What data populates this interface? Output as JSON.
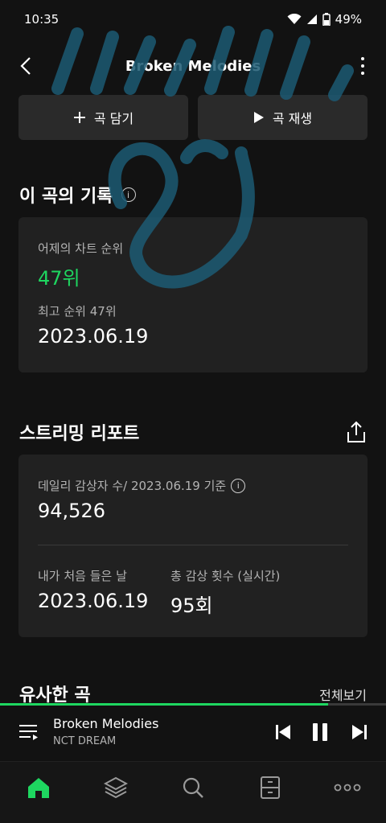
{
  "status": {
    "time": "10:35",
    "battery": "49%"
  },
  "header": {
    "title": "Broken Melodies"
  },
  "actions": {
    "add_label": "곡 담기",
    "play_label": "곡 재생"
  },
  "record": {
    "title": "이 곡의 기록",
    "yesterday_label": "어제의 차트 순위",
    "yesterday_value": "47위",
    "best_label": "최고 순위 47위",
    "best_date": "2023.06.19"
  },
  "report": {
    "title": "스트리밍 리포트",
    "daily_label": "데일리 감상자 수/ 2023.06.19 기준",
    "daily_value": "94,526",
    "first_label": "내가 처음 들은 날",
    "first_value": "2023.06.19",
    "total_label": "총 감상 횟수 (실시간)",
    "total_value": "95회"
  },
  "similar": {
    "title": "유사한 곡",
    "see_all": "전체보기"
  },
  "player": {
    "title": "Broken Melodies",
    "artist": "NCT DREAM",
    "progress": 0.85
  },
  "colors": {
    "accent": "#1ed760",
    "background": "#121212",
    "card": "#212121",
    "doodle": "#1c5a73"
  },
  "nav": [
    "home-icon",
    "library-icon",
    "search-icon",
    "storage-icon",
    "more-icon"
  ]
}
